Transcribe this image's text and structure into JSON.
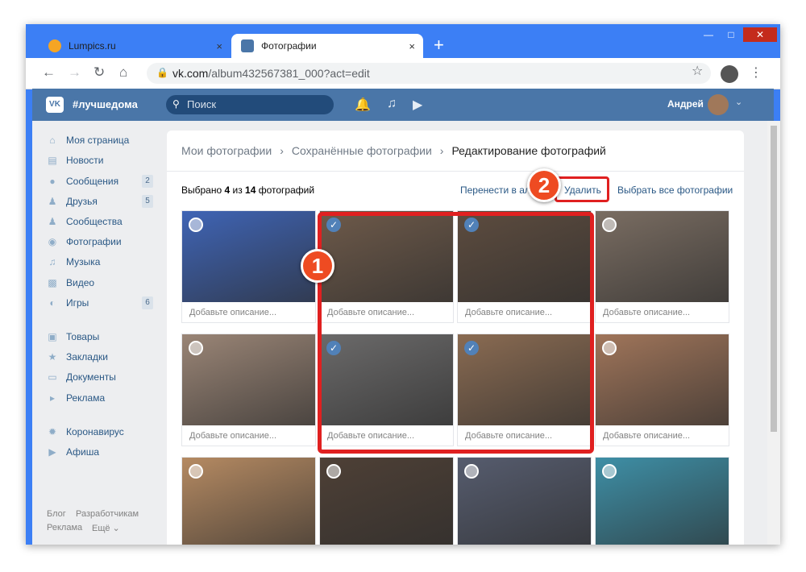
{
  "browser": {
    "tabs": [
      {
        "title": "Lumpics.ru",
        "close": "×"
      },
      {
        "title": "Фотографии",
        "close": "×"
      }
    ],
    "new_tab": "+",
    "url_host": "vk.com",
    "url_path": "/album432567381_000?act=edit"
  },
  "vk": {
    "logo": "VK",
    "brand": "#лучшедома",
    "search_placeholder": "Поиск",
    "user_name": "Андрей"
  },
  "sidebar": {
    "items": [
      {
        "label": "Моя страница",
        "badge": ""
      },
      {
        "label": "Новости",
        "badge": ""
      },
      {
        "label": "Сообщения",
        "badge": "2"
      },
      {
        "label": "Друзья",
        "badge": "5"
      },
      {
        "label": "Сообщества",
        "badge": ""
      },
      {
        "label": "Фотографии",
        "badge": ""
      },
      {
        "label": "Музыка",
        "badge": ""
      },
      {
        "label": "Видео",
        "badge": ""
      },
      {
        "label": "Игры",
        "badge": "6"
      },
      {
        "label": "Товары",
        "badge": ""
      },
      {
        "label": "Закладки",
        "badge": ""
      },
      {
        "label": "Документы",
        "badge": ""
      },
      {
        "label": "Реклама",
        "badge": ""
      },
      {
        "label": "Коронавирус",
        "badge": ""
      },
      {
        "label": "Афиша",
        "badge": ""
      }
    ],
    "footer": {
      "blog": "Блог",
      "dev": "Разработчикам",
      "ads": "Реклама",
      "more": "Ещё ⌄"
    }
  },
  "main": {
    "breadcrumb": [
      "Мои фотографии",
      "›",
      "Сохранённые фотографии",
      "›",
      "Редактирование фотографий"
    ],
    "selected_prefix": "Выбрано ",
    "selected_count": "4",
    "selected_mid": " из ",
    "total_count": "14",
    "selected_suffix": " фотографий",
    "move_label": "Перенести в ал",
    "delete_label": "Удалить",
    "select_all_label": "Выбрать все фотографии",
    "desc_placeholder": "Добавьте описание..."
  },
  "photos": [
    {
      "selected": false,
      "color": "#3f64b5"
    },
    {
      "selected": true,
      "color": "#6e5a4a"
    },
    {
      "selected": true,
      "color": "#5d4c3f"
    },
    {
      "selected": false,
      "color": "#7a6d62"
    },
    {
      "selected": false,
      "color": "#9a8576"
    },
    {
      "selected": true,
      "color": "#6b6a6a"
    },
    {
      "selected": true,
      "color": "#8a6b52"
    },
    {
      "selected": false,
      "color": "#a0755a"
    },
    {
      "selected": false,
      "color": "#b58a62"
    },
    {
      "selected": false,
      "color": "#4e4036"
    },
    {
      "selected": false,
      "color": "#565c6e"
    },
    {
      "selected": false,
      "color": "#3e8fa6"
    }
  ],
  "annotations": {
    "frame": "1",
    "delete": "2"
  }
}
